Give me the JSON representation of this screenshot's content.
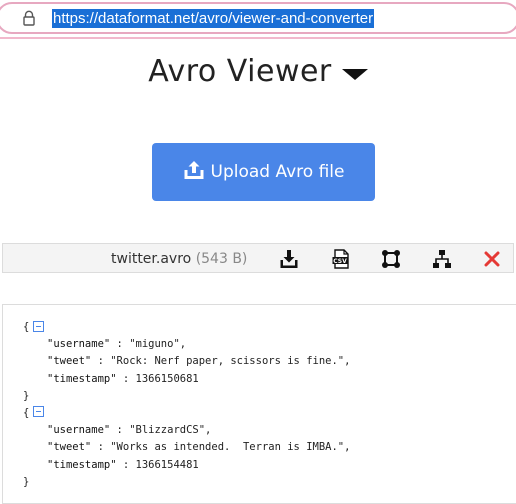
{
  "browser": {
    "url": "https://dataformat.net/avro/viewer-and-converter",
    "lock_icon": "lock-icon"
  },
  "header": {
    "title": "Avro Viewer"
  },
  "upload": {
    "label": "Upload Avro file",
    "icon": "upload-icon"
  },
  "file": {
    "name": "twitter.avro",
    "size": "(543 B)",
    "actions": [
      {
        "name": "download-icon"
      },
      {
        "name": "csv-icon"
      },
      {
        "name": "graph-icon"
      },
      {
        "name": "tree-icon"
      },
      {
        "name": "close-icon"
      }
    ]
  },
  "json": {
    "records": [
      {
        "username": "\"miguno\"",
        "tweet": "\"Rock: Nerf paper, scissors is fine.\"",
        "timestamp": "1366150681"
      },
      {
        "username": "\"BlizzardCS\"",
        "tweet": "\"Works as intended.  Terran is IMBA.\"",
        "timestamp": "1366154481"
      }
    ],
    "keys": {
      "username": "\"username\"",
      "tweet": "\"tweet\"",
      "timestamp": "\"timestamp\""
    },
    "open_brace": "{",
    "close_brace": "}",
    "separator": " : ",
    "comma": ","
  },
  "colors": {
    "accent": "#4a86e8",
    "close": "#e53935",
    "url_highlight": "#1a6fd6"
  }
}
